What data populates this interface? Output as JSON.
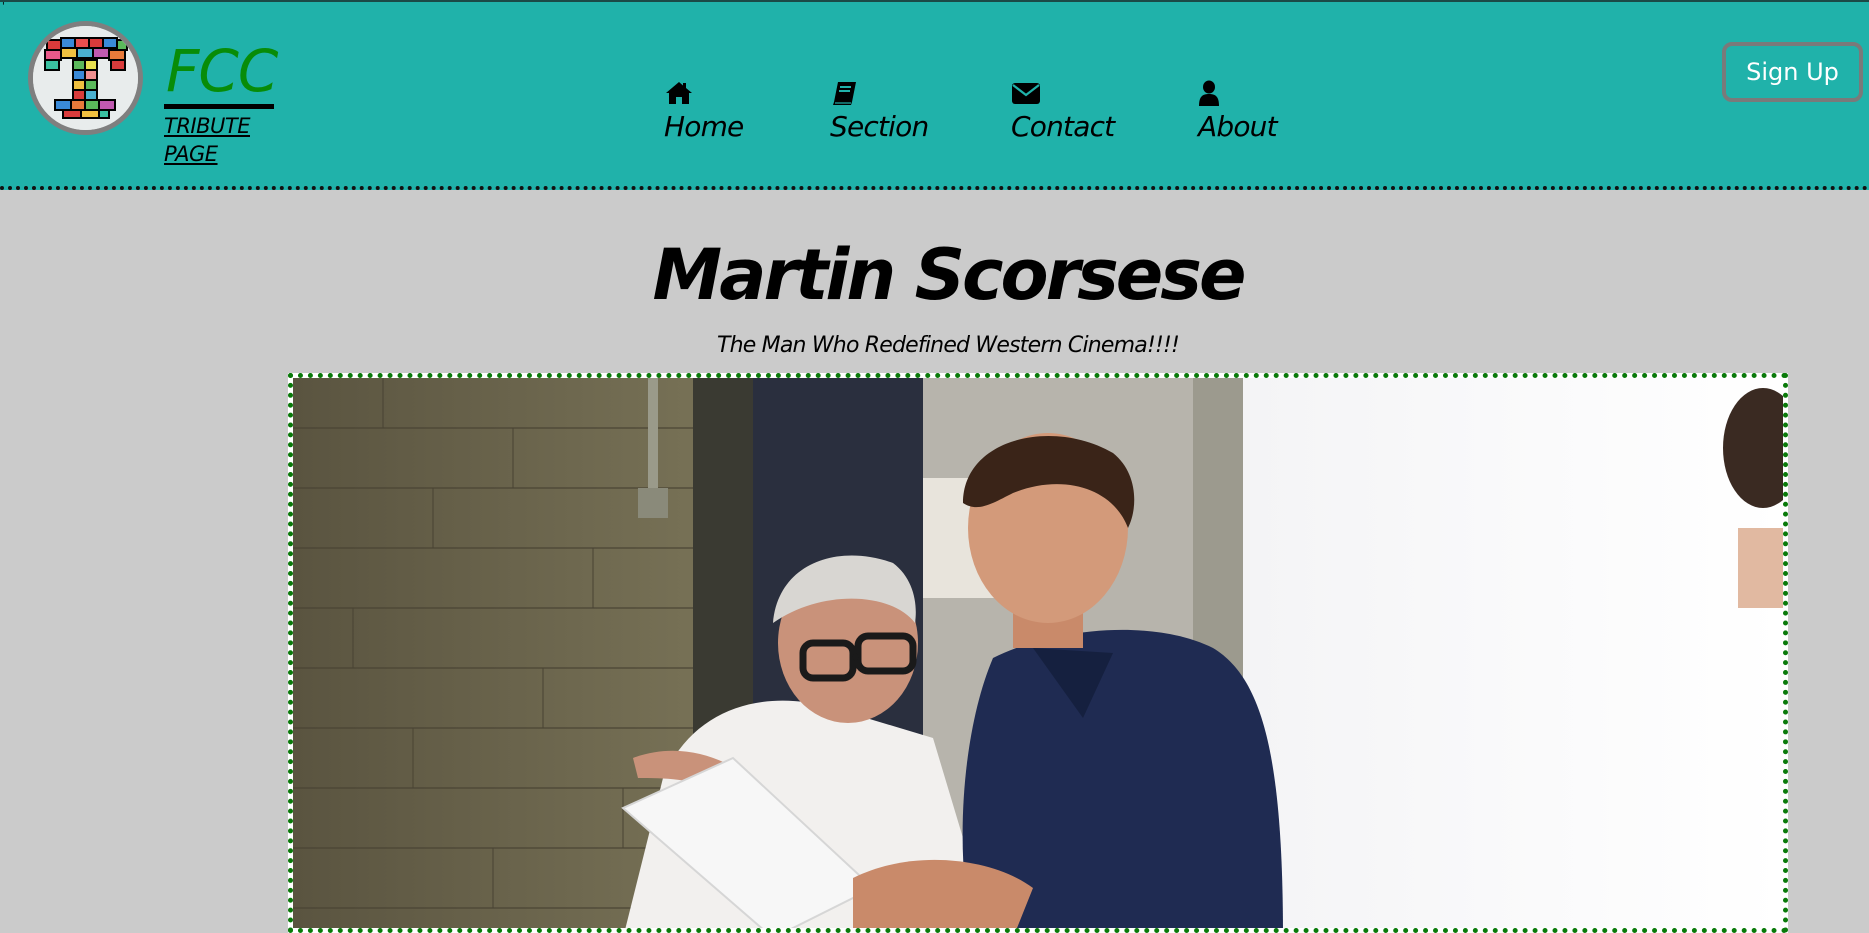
{
  "header": {
    "stray_mark": "'",
    "brand": {
      "title": "FCC",
      "subtitle": "TRIBUTE PAGE"
    },
    "nav": [
      {
        "label": "Home",
        "icon": "home-icon"
      },
      {
        "label": "Section",
        "icon": "book-icon"
      },
      {
        "label": "Contact",
        "icon": "envelope-icon"
      },
      {
        "label": "About",
        "icon": "user-icon"
      }
    ],
    "signup_label": "Sign Up"
  },
  "main": {
    "title": "Martin Scorsese",
    "subtitle": "The Man Who Redefined Western Cinema!!!!",
    "photo": {
      "description_icon": "photo-of-martin-scorsese-with-actor"
    }
  },
  "colors": {
    "header_bg": "#20b2aa",
    "page_bg": "#cbcbcb",
    "brand_green": "#088c08",
    "frame_border": "#0a7a0a",
    "signup_text": "#ffffff"
  }
}
